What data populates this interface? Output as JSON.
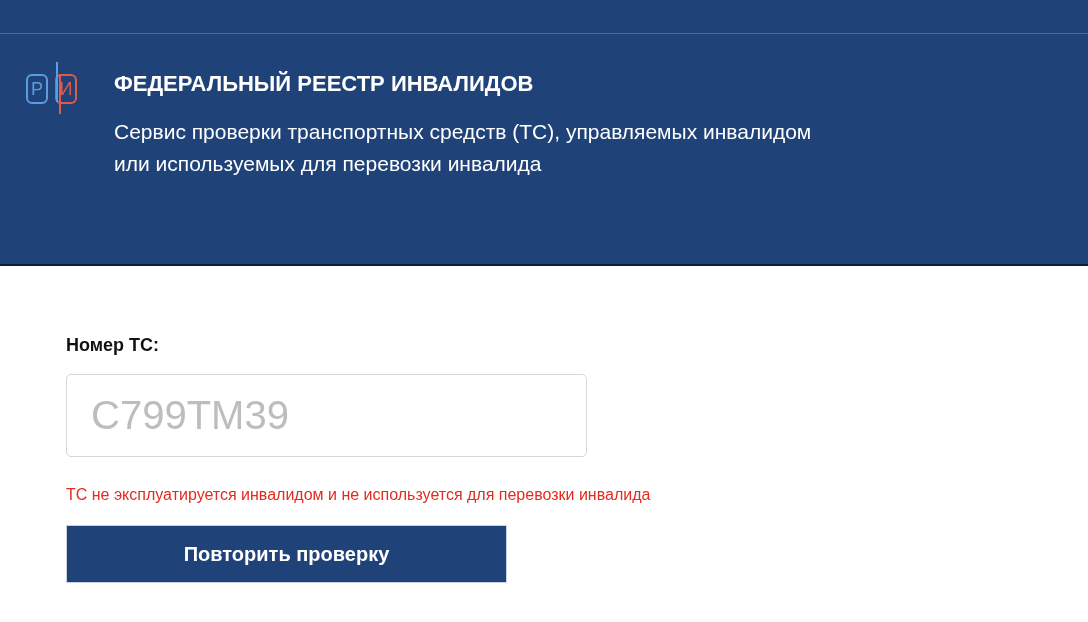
{
  "header": {
    "logo": {
      "letters": [
        "Р",
        "И"
      ]
    },
    "title": "ФЕДЕРАЛЬНЫЙ РЕЕСТР ИНВАЛИДОВ",
    "subtitle_lines": [
      "Сервис проверки транспортных средств (ТС), управляемых инвалидом",
      "или используемых для перевозки инвалида"
    ]
  },
  "form": {
    "label": "Номер ТС:",
    "field": {
      "placeholder": "С799ТМ39"
    },
    "error": "ТС не эксплуатируется инвалидом и не используется для перевозки инвалида",
    "button": "Повторить проверку"
  }
}
